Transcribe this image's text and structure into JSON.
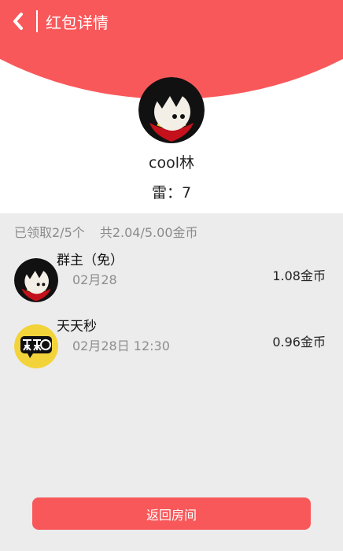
{
  "header": {
    "title": "红包详情"
  },
  "profile": {
    "name": "cool林",
    "mine_label": "雷：7"
  },
  "summary": {
    "received_text": "已领取2/5个",
    "total_text": "共2.04/5.00金币"
  },
  "records": [
    {
      "name": "群主（免）",
      "time": "02月28",
      "amount": "1.08金币",
      "avatar": "cartoon-avatar"
    },
    {
      "name": "天天秒",
      "time": "02月28日 12:30",
      "amount": "0.96金币",
      "avatar": "tiantianmiao-logo"
    }
  ],
  "actions": {
    "return_label": "返回房间"
  },
  "colors": {
    "accent": "#f9585a",
    "page_bg": "#ececec"
  }
}
